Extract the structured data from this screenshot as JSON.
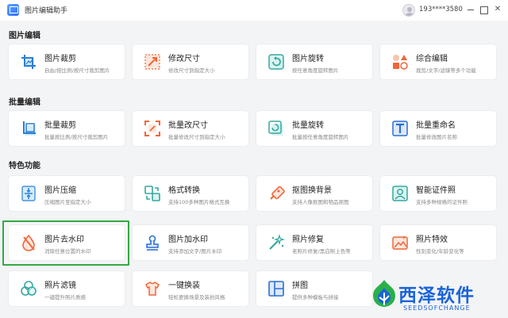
{
  "window": {
    "title": "图片编辑助手",
    "account": "193****3580"
  },
  "sections": [
    {
      "title": "图片编辑"
    },
    {
      "title": "批量编辑"
    },
    {
      "title": "特色功能"
    }
  ],
  "cards": [
    {
      "title": "图片裁剪",
      "desc": "自由/按比例/按尺寸裁剪图片",
      "icon": "crop-icon"
    },
    {
      "title": "修改尺寸",
      "desc": "修改尺寸到指定大小",
      "icon": "resize-icon"
    },
    {
      "title": "图片旋转",
      "desc": "按任意角度旋转图片",
      "icon": "rotate-icon"
    },
    {
      "title": "综合编辑",
      "desc": "裁剪/文字/滤镜等多个功能",
      "icon": "shapes-icon"
    },
    {
      "title": "批量裁剪",
      "desc": "批量按比例/按尺寸裁剪图片",
      "icon": "batch-crop-icon"
    },
    {
      "title": "批量改尺寸",
      "desc": "批量修改尺寸到指定大小",
      "icon": "batch-resize-icon"
    },
    {
      "title": "批量旋转",
      "desc": "批量按任意角度旋转图片",
      "icon": "batch-rotate-icon"
    },
    {
      "title": "批量重命名",
      "desc": "批量修改图片名称",
      "icon": "rename-icon"
    },
    {
      "title": "图片压缩",
      "desc": "压缩图片至指定大小",
      "icon": "compress-icon"
    },
    {
      "title": "格式转换",
      "desc": "支持100多种图片格式互换",
      "icon": "convert-icon"
    },
    {
      "title": "抠图换背景",
      "desc": "支持人像抠图和物品抠图",
      "icon": "cutout-icon"
    },
    {
      "title": "智能证件照",
      "desc": "支持多种规格的证件照",
      "icon": "id-photo-icon"
    },
    {
      "title": "图片去水印",
      "desc": "消除任意位置的水印",
      "icon": "remove-watermark-icon"
    },
    {
      "title": "图片加水印",
      "desc": "支持添加文字/图片水印",
      "icon": "add-watermark-icon"
    },
    {
      "title": "照片修复",
      "desc": "老照片修复/黑白照上色等",
      "icon": "magic-wand-icon"
    },
    {
      "title": "照片特效",
      "desc": "性别变化/年龄变化等",
      "icon": "effects-icon"
    },
    {
      "title": "照片滤镜",
      "desc": "一键提升照片质感",
      "icon": "filter-icon"
    },
    {
      "title": "一键换装",
      "desc": "轻松更换场景及装扮风格",
      "icon": "outfit-icon"
    },
    {
      "title": "拼图",
      "desc": "提供多种模板与拼接",
      "icon": "collage-icon"
    }
  ],
  "watermark": {
    "text": "西泽软件",
    "sub": "SEEDSOFCHANGE"
  },
  "colors": {
    "accent": "#1a64d8",
    "highlight": "#35a844",
    "orange": "#f0663a",
    "teal": "#35a8a0"
  }
}
